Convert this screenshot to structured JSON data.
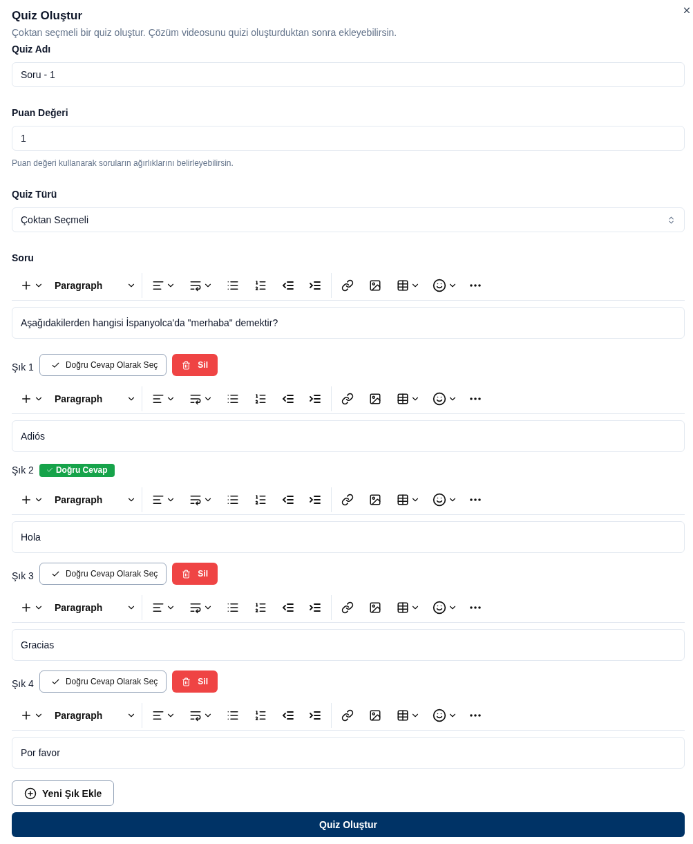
{
  "dialog": {
    "title": "Quiz Oluştur",
    "description": "Çoktan seçmeli bir quiz oluştur. Çözüm videosunu quizi oluşturduktan sonra ekleyebilirsin."
  },
  "fields": [
    {
      "kind": "input",
      "label": "Quiz Adı",
      "value": "Soru - 1"
    },
    {
      "kind": "input",
      "label": "Puan Değeri",
      "value": "1",
      "hint": "Puan değeri kullanarak soruların ağırlıklarını belirleyebilirsin."
    },
    {
      "kind": "select",
      "label": "Quiz Türü",
      "value": "Çoktan Seçmeli"
    }
  ],
  "question": {
    "label": "Soru",
    "block_style": "Paragraph",
    "text": "Aşağıdakilerden hangisi İspanyolca'da \"merhaba\" demektir?"
  },
  "options": [
    {
      "label": "Şık 1",
      "correct": false,
      "select_label": "Doğru Cevap Olarak Seç",
      "delete_label": "Sil",
      "block_style": "Paragraph",
      "text": "Adiós"
    },
    {
      "label": "Şık 2",
      "correct": true,
      "badge_label": "Doğru Cevap",
      "block_style": "Paragraph",
      "text": "Hola"
    },
    {
      "label": "Şık 3",
      "correct": false,
      "select_label": "Doğru Cevap Olarak Seç",
      "delete_label": "Sil",
      "block_style": "Paragraph",
      "text": "Gracias"
    },
    {
      "label": "Şık 4",
      "correct": false,
      "select_label": "Doğru Cevap Olarak Seç",
      "delete_label": "Sil",
      "block_style": "Paragraph",
      "text": "Por favor"
    }
  ],
  "add_option_label": "Yeni Şık Ekle",
  "submit_label": "Quiz Oluştur"
}
